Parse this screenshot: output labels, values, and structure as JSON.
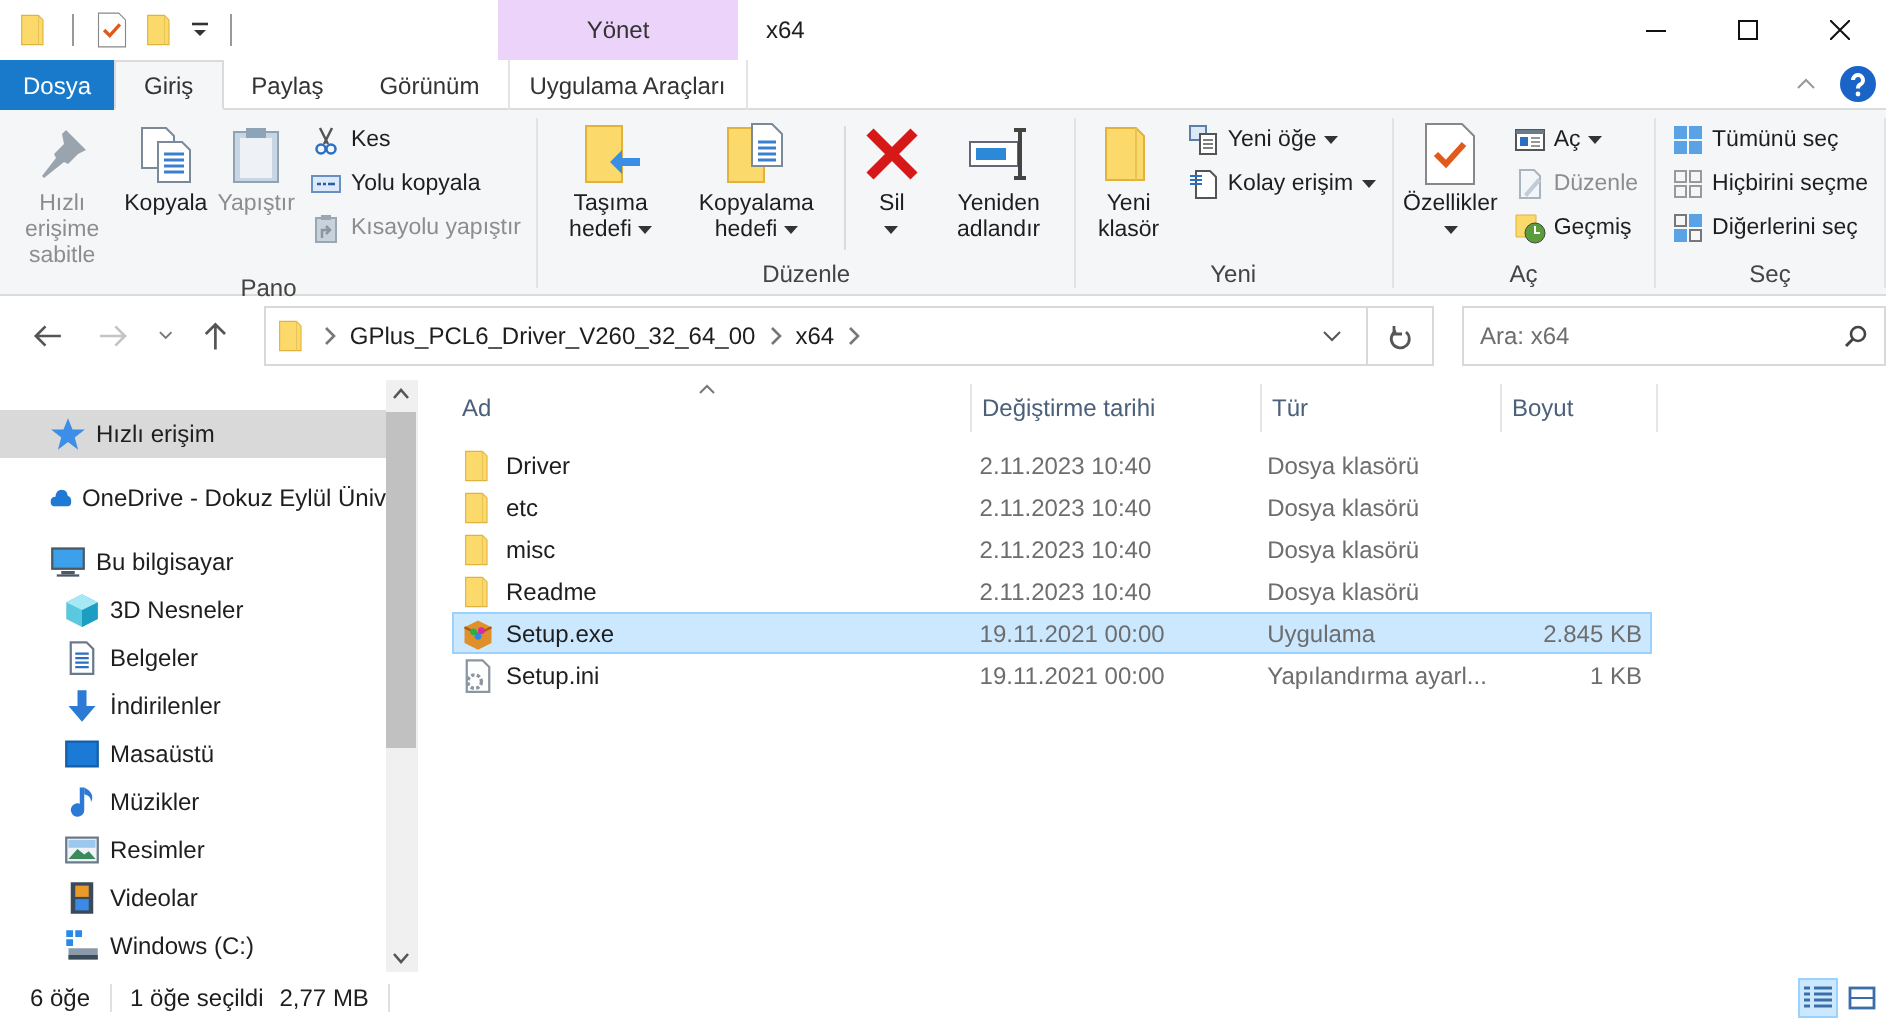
{
  "window": {
    "title": "x64"
  },
  "context_header": {
    "label": "Yönet"
  },
  "ribbon_tabs": [
    {
      "label": "Dosya",
      "kind": "file",
      "selected": false
    },
    {
      "label": "Giriş",
      "kind": "tab",
      "selected": true
    },
    {
      "label": "Paylaş",
      "kind": "tab",
      "selected": false
    },
    {
      "label": "Görünüm",
      "kind": "tab",
      "selected": false
    },
    {
      "label": "Uygulama Araçları",
      "kind": "context",
      "selected": false
    }
  ],
  "ribbon_groups": [
    {
      "label": "Pano",
      "items": [
        {
          "kind": "large",
          "label": "Hızlı erişime sabitle",
          "disabled": true,
          "dropdown": false
        },
        {
          "kind": "large",
          "label": "Kopyala",
          "disabled": false,
          "dropdown": false
        },
        {
          "kind": "large",
          "label": "Yapıştır",
          "disabled": true,
          "dropdown": false
        },
        {
          "kind": "stack",
          "items": [
            {
              "label": "Kes",
              "disabled": false,
              "dropdown": false
            },
            {
              "label": "Yolu kopyala",
              "disabled": false,
              "dropdown": false
            },
            {
              "label": "Kısayolu yapıştır",
              "disabled": true,
              "dropdown": false
            }
          ]
        }
      ]
    },
    {
      "label": "Düzenle",
      "items": [
        {
          "kind": "large",
          "label": "Taşıma hedefi",
          "disabled": false,
          "dropdown": true
        },
        {
          "kind": "large",
          "label": "Kopyalama hedefi",
          "disabled": false,
          "dropdown": true
        },
        {
          "kind": "separator"
        },
        {
          "kind": "large",
          "label": "Sil",
          "disabled": false,
          "dropdown": true
        },
        {
          "kind": "large",
          "label": "Yeniden adlandır",
          "disabled": false,
          "dropdown": false
        }
      ]
    },
    {
      "label": "Yeni",
      "items": [
        {
          "kind": "large",
          "label": "Yeni klasör",
          "disabled": false,
          "dropdown": false
        },
        {
          "kind": "stack",
          "items": [
            {
              "label": "Yeni öğe",
              "disabled": false,
              "dropdown": true
            },
            {
              "label": "Kolay erişim",
              "disabled": false,
              "dropdown": true
            }
          ]
        }
      ]
    },
    {
      "label": "Aç",
      "items": [
        {
          "kind": "large",
          "label": "Özellikler",
          "disabled": false,
          "dropdown": true
        },
        {
          "kind": "stack",
          "items": [
            {
              "label": "Aç",
              "disabled": false,
              "dropdown": true
            },
            {
              "label": "Düzenle",
              "disabled": true,
              "dropdown": false
            },
            {
              "label": "Geçmiş",
              "disabled": false,
              "dropdown": false
            }
          ]
        }
      ]
    },
    {
      "label": "Seç",
      "items": [
        {
          "kind": "stack",
          "items": [
            {
              "label": "Tümünü seç",
              "disabled": false,
              "dropdown": false
            },
            {
              "label": "Hiçbirini seçme",
              "disabled": false,
              "dropdown": false
            },
            {
              "label": "Diğerlerini seç",
              "disabled": false,
              "dropdown": false
            }
          ]
        }
      ]
    }
  ],
  "address_bar": {
    "breadcrumbs": [
      "GPlus_PCL6_Driver_V260_32_64_00",
      "x64"
    ]
  },
  "search": {
    "placeholder": "Ara: x64"
  },
  "sidebar": {
    "items": [
      {
        "label": "Hızlı erişim",
        "selected": true
      },
      {
        "label": "OneDrive - Dokuz Eylül Üniv",
        "selected": false
      },
      {
        "label": "Bu bilgisayar",
        "selected": false,
        "children": [
          {
            "label": "3D Nesneler",
            "selected": false
          },
          {
            "label": "Belgeler",
            "selected": false
          },
          {
            "label": "İndirilenler",
            "selected": false
          },
          {
            "label": "Masaüstü",
            "selected": false
          },
          {
            "label": "Müzikler",
            "selected": false
          },
          {
            "label": "Resimler",
            "selected": false
          },
          {
            "label": "Videolar",
            "selected": false
          },
          {
            "label": "Windows (C:)",
            "selected": false
          }
        ]
      }
    ]
  },
  "file_list": {
    "columns": [
      "Ad",
      "Değiştirme tarihi",
      "Tür",
      "Boyut"
    ],
    "rows": [
      {
        "kind": "folder",
        "name": "Driver",
        "date": "2.11.2023 10:40",
        "type": "Dosya klasörü",
        "selected": false
      },
      {
        "kind": "folder",
        "name": "etc",
        "date": "2.11.2023 10:40",
        "type": "Dosya klasörü",
        "selected": false
      },
      {
        "kind": "folder",
        "name": "misc",
        "date": "2.11.2023 10:40",
        "type": "Dosya klasörü",
        "selected": false
      },
      {
        "kind": "folder",
        "name": "Readme",
        "date": "2.11.2023 10:40",
        "type": "Dosya klasörü",
        "selected": false
      },
      {
        "kind": "exe",
        "name": "Setup.exe",
        "date": "19.11.2021 00:00",
        "type": "Uygulama",
        "size": "2.845 KB",
        "selected": true
      },
      {
        "kind": "ini",
        "name": "Setup.ini",
        "date": "19.11.2021 00:00",
        "type": "Yapılandırma ayarl...",
        "size": "1 KB",
        "selected": false
      }
    ]
  },
  "status_bar": {
    "item_count": "6 öğe",
    "selection": "1 öğe seçildi",
    "selection_size": "2,77 MB"
  },
  "view_modes": [
    {
      "kind": "details",
      "selected": true
    },
    {
      "kind": "large_icons",
      "selected": false
    }
  ]
}
